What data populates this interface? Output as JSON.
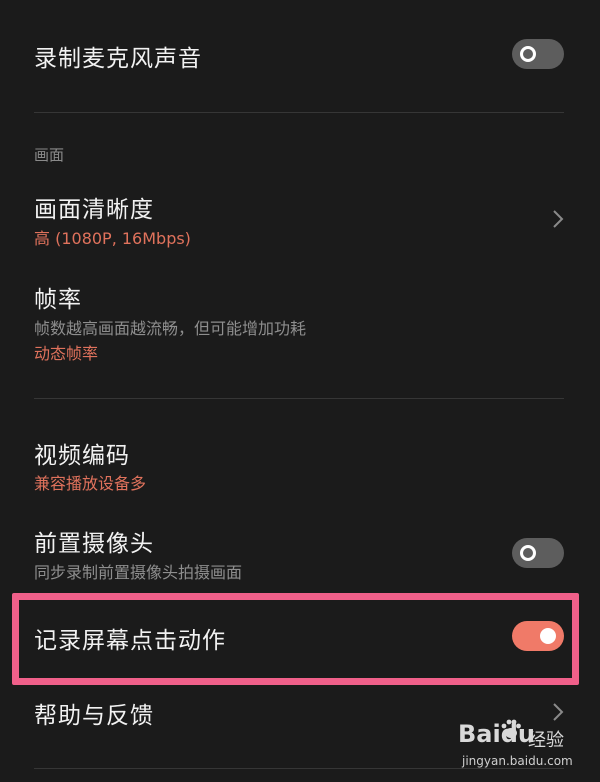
{
  "settings": {
    "record_mic": {
      "title": "录制麦克风声音",
      "enabled": false
    },
    "section_picture": "画面",
    "resolution": {
      "title": "画面清晰度",
      "value": "高 (1080P, 16Mbps)"
    },
    "frame_rate": {
      "title": "帧率",
      "description": "帧数越高画面越流畅，但可能增加功耗",
      "value": "动态帧率"
    },
    "video_codec": {
      "title": "视频编码",
      "value": "兼容播放设备多"
    },
    "front_camera": {
      "title": "前置摄像头",
      "description": "同步录制前置摄像头拍摄画面",
      "enabled": false
    },
    "record_touches": {
      "title": "记录屏幕点击动作",
      "enabled": true
    },
    "help": {
      "title": "帮助与反馈"
    }
  },
  "watermark": {
    "logo_text": "Bai",
    "logo_du": "du",
    "experience": "经验",
    "url": "jingyan.baidu.com"
  },
  "colors": {
    "background": "#1b1b1b",
    "accent": "#e0725c",
    "toggle_on": "#f07a68",
    "toggle_off": "#5d5d5d",
    "highlight_border": "#f0608a"
  }
}
